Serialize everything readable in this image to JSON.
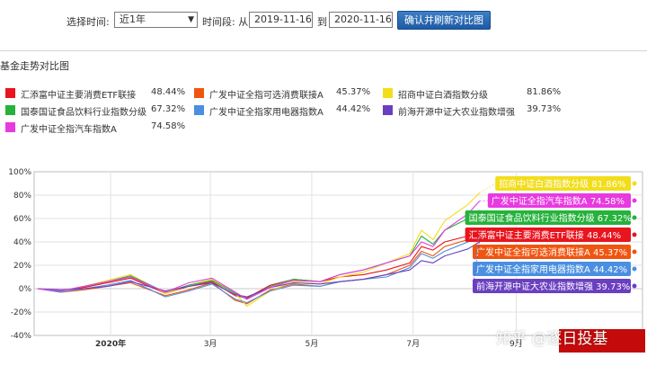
{
  "controls": {
    "time_label": "选择时间:",
    "period_value": "近1年",
    "range_label": "时间段: 从",
    "start_date": "2019-11-16",
    "to_label": "到",
    "end_date": "2020-11-16",
    "confirm_button": "确认并刷新对比图"
  },
  "panel_title": "基金走势对比图",
  "watermark": "知乎 @逐日投基",
  "chart_data": {
    "type": "line",
    "x": [
      "2019-11-18",
      "2019-12-02",
      "2019-12-16",
      "2019-12-30",
      "2020-01-13",
      "2020-02-03",
      "2020-02-17",
      "2020-03-02",
      "2020-03-16",
      "2020-03-23",
      "2020-04-06",
      "2020-04-20",
      "2020-05-06",
      "2020-05-18",
      "2020-06-01",
      "2020-06-15",
      "2020-06-29",
      "2020-07-06",
      "2020-07-13",
      "2020-07-20",
      "2020-08-03",
      "2020-08-10"
    ],
    "x_ticks": [
      {
        "label": "2020年",
        "date": "2020-01-01"
      },
      {
        "label": "3月",
        "date": "2020-03-01"
      },
      {
        "label": "5月",
        "date": "2020-05-01"
      },
      {
        "label": "7月",
        "date": "2020-07-01"
      },
      {
        "label": "9月",
        "date": "2020-09-01"
      }
    ],
    "x_range": [
      "2019-11-16",
      "2020-11-16"
    ],
    "ylim": [
      -40,
      100
    ],
    "y_ticks": [
      -40,
      -20,
      0,
      20,
      40,
      60,
      80,
      100
    ],
    "y_unit": "%",
    "grid": true,
    "series": [
      {
        "name": "汇添富中证主要消费ETF联接",
        "color": "#e8141e",
        "final": "48.44%",
        "values": [
          0,
          -2,
          1,
          5,
          9,
          -4,
          2,
          6,
          -6,
          -8,
          3,
          8,
          6,
          10,
          12,
          16,
          22,
          36,
          33,
          40,
          45,
          48
        ]
      },
      {
        "name": "广发中证全指可选消费联接A",
        "color": "#f0550f",
        "final": "45.37%",
        "values": [
          0,
          -3,
          -1,
          2,
          5,
          -6,
          -1,
          5,
          -10,
          -13,
          -1,
          4,
          2,
          6,
          8,
          12,
          20,
          32,
          28,
          36,
          42,
          45
        ]
      },
      {
        "name": "招商中证白酒指数分级",
        "color": "#f2dd1a",
        "final": "81.86%",
        "values": [
          0,
          -2,
          2,
          7,
          12,
          -4,
          3,
          8,
          -4,
          -15,
          -2,
          6,
          4,
          10,
          14,
          22,
          30,
          50,
          42,
          58,
          72,
          82
        ]
      },
      {
        "name": "国泰国证食品饮料行业指数分级",
        "color": "#26b23c",
        "final": "67.32%",
        "values": [
          0,
          -2,
          2,
          6,
          11,
          -3,
          3,
          7,
          -4,
          -9,
          2,
          8,
          6,
          12,
          16,
          22,
          28,
          45,
          38,
          50,
          60,
          67
        ]
      },
      {
        "name": "广发中证全指家用电器指数A",
        "color": "#4a8fe0",
        "final": "44.42%",
        "values": [
          0,
          -3,
          0,
          3,
          7,
          -7,
          -2,
          4,
          -9,
          -12,
          -2,
          3,
          2,
          6,
          8,
          10,
          18,
          30,
          26,
          32,
          40,
          44
        ]
      },
      {
        "name": "前海开源中证大农业指数增强",
        "color": "#6a3fc0",
        "final": "39.73%",
        "values": [
          0,
          -1,
          0,
          2,
          6,
          -2,
          2,
          5,
          -5,
          -7,
          1,
          5,
          4,
          6,
          8,
          12,
          16,
          24,
          22,
          28,
          34,
          40
        ]
      },
      {
        "name": "广发中证全指汽车指数A",
        "color": "#e83ae0",
        "final": "74.58%",
        "values": [
          0,
          -2,
          2,
          6,
          10,
          -3,
          5,
          9,
          -3,
          -9,
          1,
          7,
          6,
          12,
          16,
          22,
          28,
          40,
          36,
          50,
          64,
          75
        ]
      }
    ],
    "end_labels_order": [
      2,
      6,
      3,
      0,
      1,
      4,
      5
    ]
  }
}
